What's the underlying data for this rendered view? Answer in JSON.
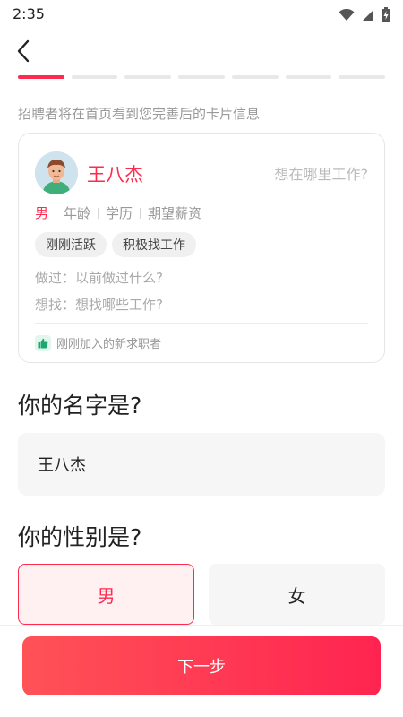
{
  "status_bar": {
    "time": "2:35"
  },
  "progress": {
    "total_steps": 7,
    "current_step": 1
  },
  "hint": "招聘者将在首页看到您完善后的卡片信息",
  "card": {
    "name": "王八杰",
    "where": "想在哪里工作?",
    "attrs": {
      "gender": "男",
      "age": "年龄",
      "education": "学历",
      "salary": "期望薪资"
    },
    "tags": [
      "刚刚活跃",
      "积极找工作"
    ],
    "did": "做过：以前做过什么?",
    "want": "想找：想找哪些工作?",
    "footer": "刚刚加入的新求职者"
  },
  "name_question": "你的名字是?",
  "name_value": "王八杰",
  "gender_question": "你的性别是?",
  "gender_options": {
    "male": "男",
    "female": "女"
  },
  "selected_gender": "male",
  "next_button": "下一步",
  "colors": {
    "accent": "#ff2a4e",
    "muted": "#999999"
  }
}
